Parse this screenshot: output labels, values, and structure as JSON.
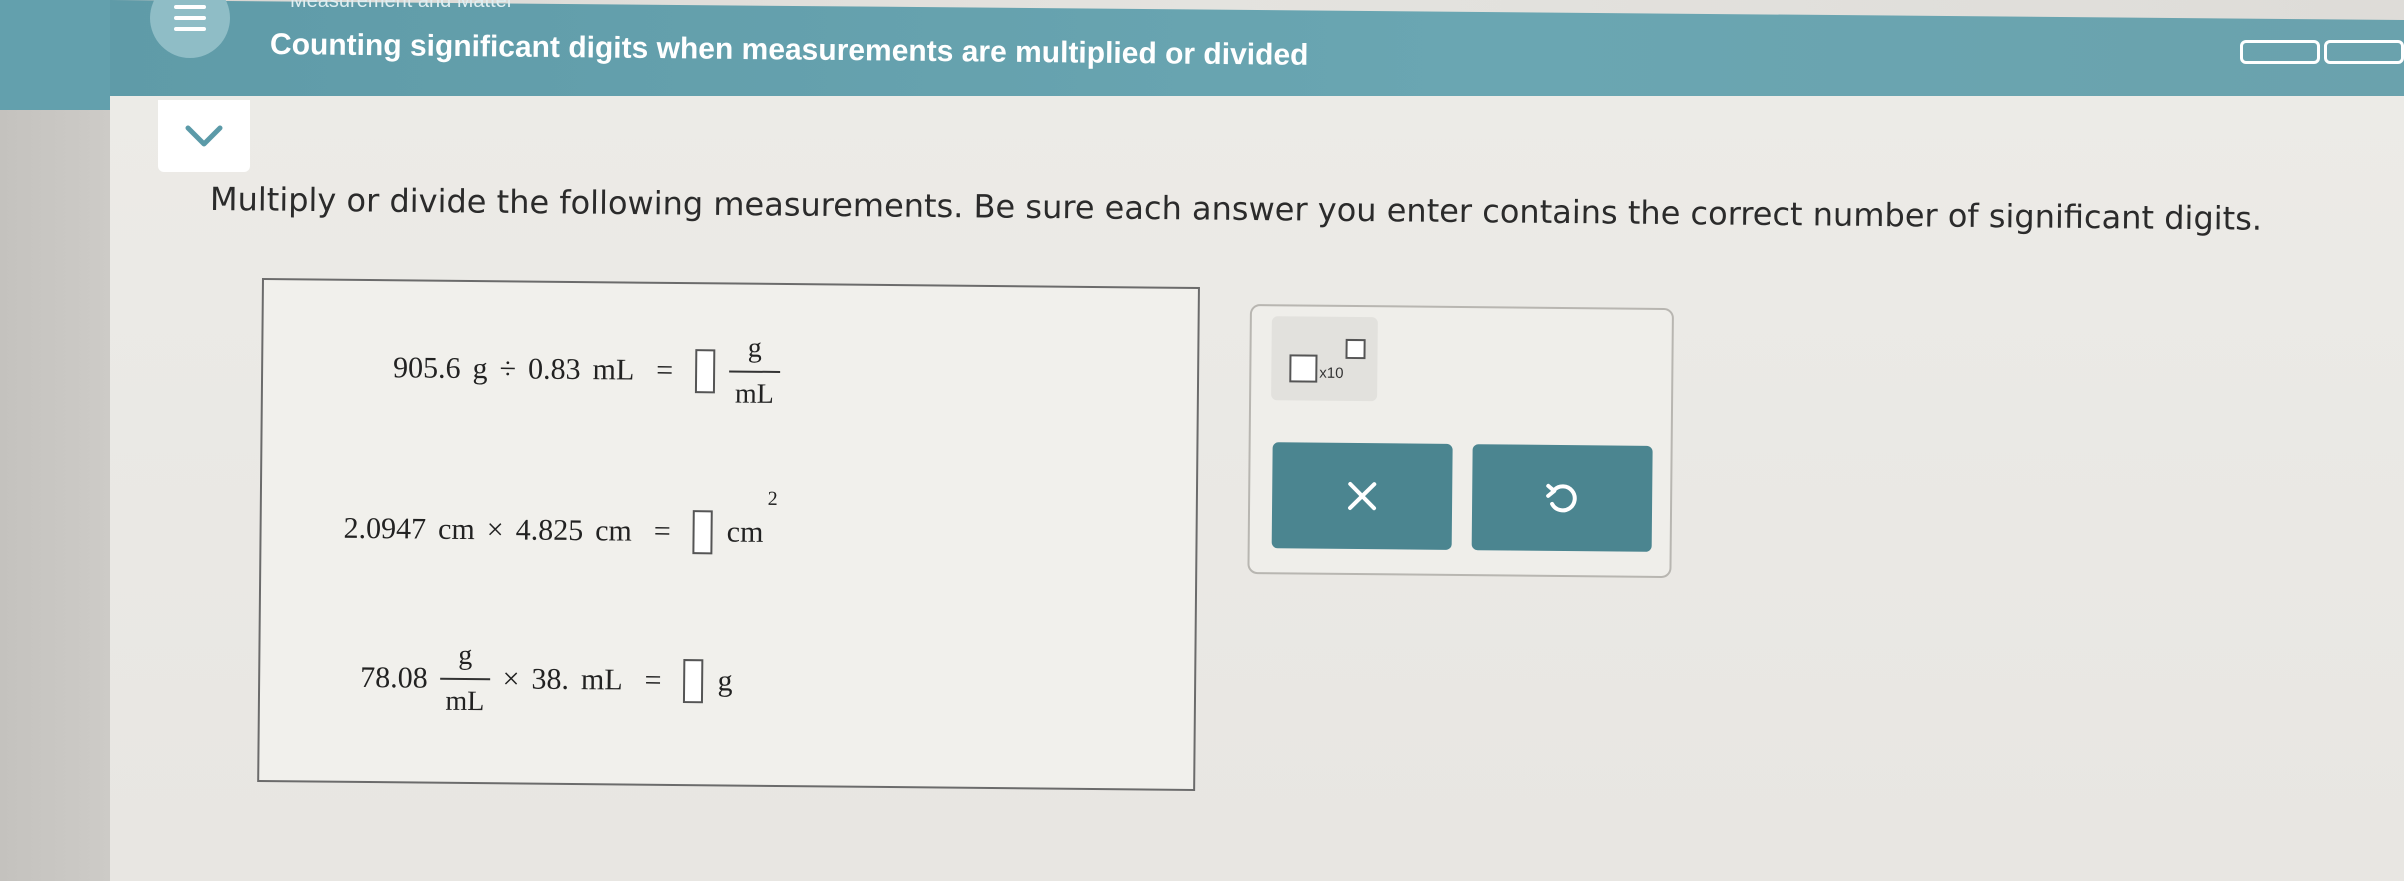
{
  "header": {
    "breadcrumb": "Measurement and Matter",
    "title": "Counting significant digits when measurements are multiplied or divided"
  },
  "instructions": "Multiply or divide the following measurements. Be sure each answer you enter contains the correct number of significant digits.",
  "problems": [
    {
      "left_value": "905.6",
      "left_unit": "g",
      "operator": "÷",
      "right_value": "0.83",
      "right_unit": "mL",
      "equals": "=",
      "answer_value": "",
      "answer_unit_num": "g",
      "answer_unit_den": "mL"
    },
    {
      "left_value": "2.0947",
      "left_unit": "cm",
      "operator": "×",
      "right_value": "4.825",
      "right_unit": "cm",
      "equals": "=",
      "answer_value": "",
      "answer_unit": "cm",
      "answer_unit_exp": "2"
    },
    {
      "left_value": "78.08",
      "left_unit_num": "g",
      "left_unit_den": "mL",
      "operator": "×",
      "right_value": "38.",
      "right_unit": "mL",
      "equals": "=",
      "answer_value": "",
      "answer_unit": "g"
    }
  ],
  "tools": {
    "sci_notation_label": "x10",
    "clear_icon": "close-icon",
    "undo_icon": "undo-icon"
  },
  "colors": {
    "header_bg": "#6aa6b2",
    "button_bg": "#4b8590",
    "page_bg": "#e8e6e2"
  }
}
